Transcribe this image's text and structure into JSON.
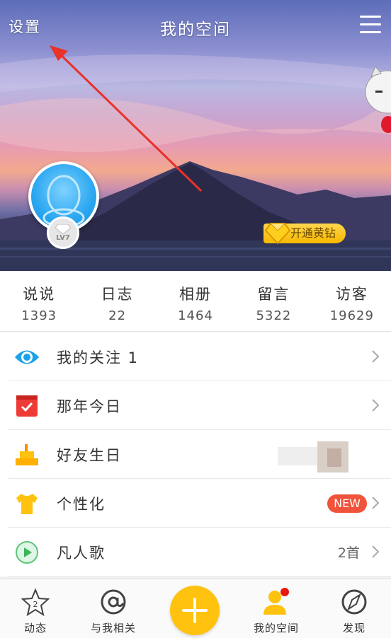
{
  "header": {
    "title": "我的空间",
    "settings_label": "设置",
    "vip_label": "开通黄钻",
    "level_label": "LV7"
  },
  "stats": [
    {
      "label": "说说",
      "value": "1393"
    },
    {
      "label": "日志",
      "value": "22"
    },
    {
      "label": "相册",
      "value": "1464"
    },
    {
      "label": "留言",
      "value": "5322"
    },
    {
      "label": "访客",
      "value": "19629"
    }
  ],
  "menu": [
    {
      "label": "我的关注 1",
      "icon": "eye-icon",
      "right": ""
    },
    {
      "label": "那年今日",
      "icon": "calendar-check-icon",
      "right": ""
    },
    {
      "label": "好友生日",
      "icon": "birthday-cake-icon",
      "right": ""
    },
    {
      "label": "个性化",
      "icon": "tshirt-icon",
      "badge": "NEW"
    },
    {
      "label": "凡人歌",
      "icon": "play-icon",
      "right": "2首"
    }
  ],
  "bottom_nav": [
    {
      "label": "动态",
      "icon": "star-icon"
    },
    {
      "label": "与我相关",
      "icon": "at-icon"
    },
    {
      "label": "我的空间",
      "icon": "user-icon"
    },
    {
      "label": "发现",
      "icon": "compass-icon"
    }
  ],
  "colors": {
    "accent_yellow": "#ffc20e",
    "badge_red": "#f0523a",
    "qq_blue": "#2aa6f0"
  }
}
